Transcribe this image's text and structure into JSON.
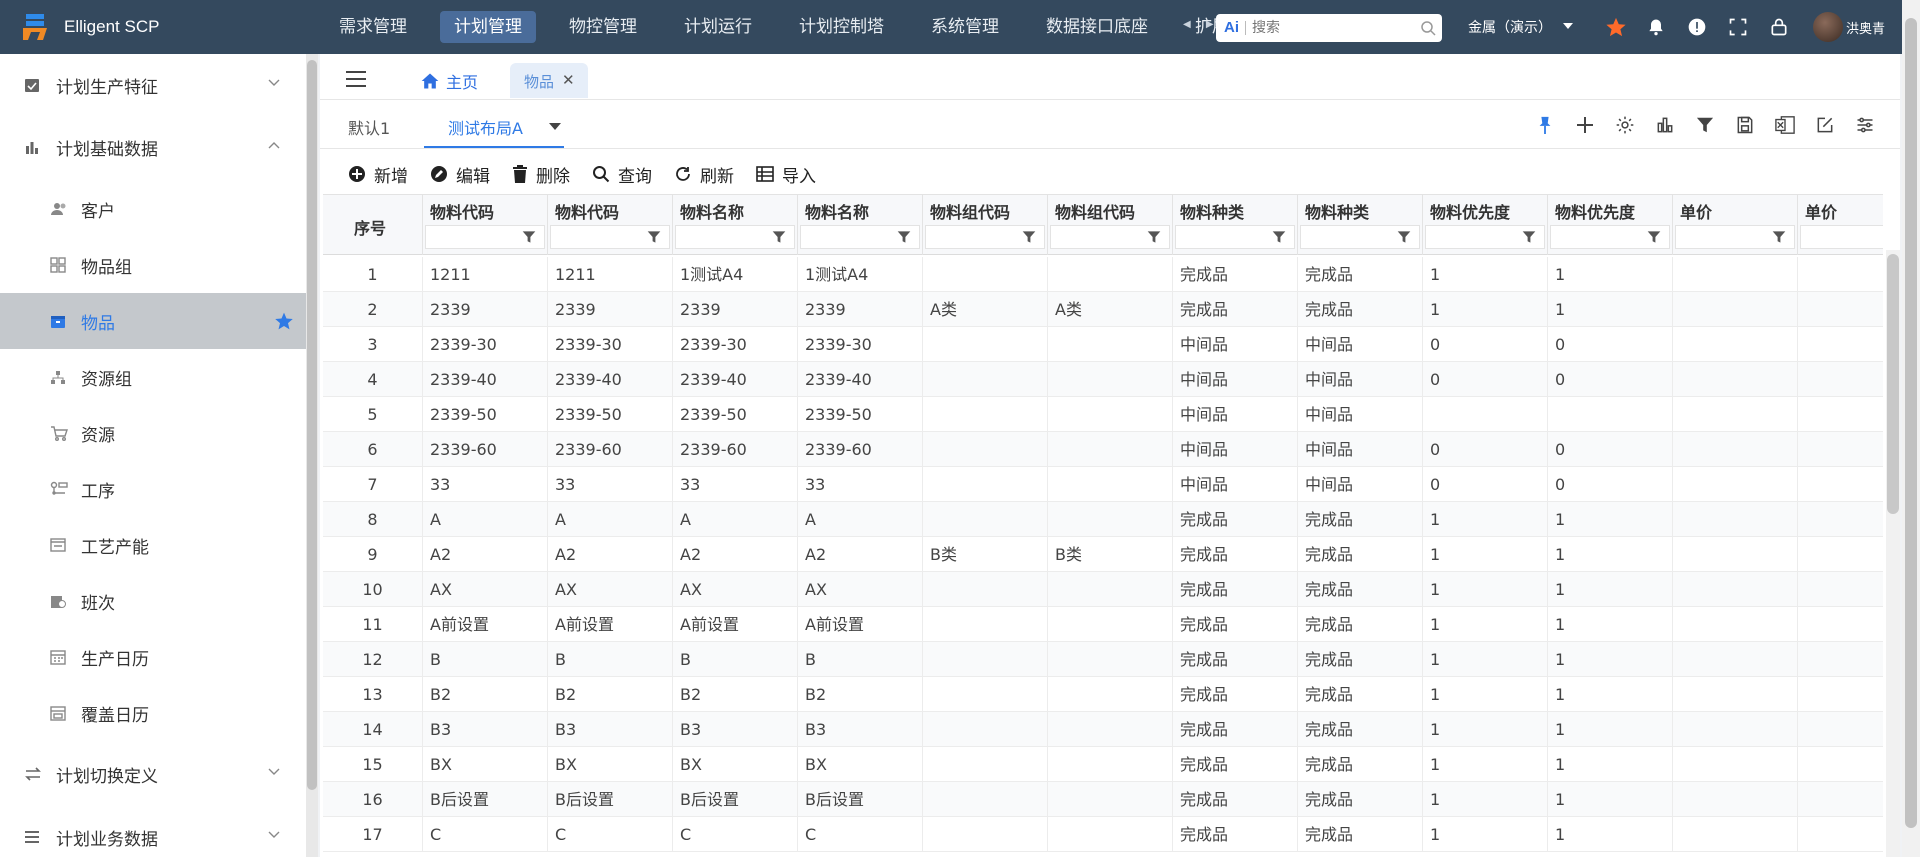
{
  "app": {
    "title": "Elligent SCP"
  },
  "topnav": [
    "需求管理",
    "计划管理",
    "物控管理",
    "计划运行",
    "计划控制塔",
    "系统管理",
    "数据接口底座",
    "扩展"
  ],
  "topnav_active": 1,
  "search": {
    "placeholder": "搜索"
  },
  "tenant": "金属（演示）",
  "user": {
    "name": "洪奥青"
  },
  "sidebar": {
    "groups": [
      {
        "label": "计划生产特征",
        "icon": "calendar-check-icon",
        "expanded": false
      },
      {
        "label": "计划基础数据",
        "icon": "bar-chart-icon",
        "expanded": true
      },
      {
        "label": "计划切换定义",
        "icon": "swap-icon",
        "expanded": false
      },
      {
        "label": "计划业务数据",
        "icon": "list-icon",
        "expanded": false
      }
    ],
    "items": [
      {
        "label": "客户",
        "icon": "users-icon"
      },
      {
        "label": "物品组",
        "icon": "grid-icon"
      },
      {
        "label": "物品",
        "icon": "box-icon",
        "active": true
      },
      {
        "label": "资源组",
        "icon": "hierarchy-icon"
      },
      {
        "label": "资源",
        "icon": "cart-icon"
      },
      {
        "label": "工序",
        "icon": "process-icon"
      },
      {
        "label": "工艺产能",
        "icon": "window-icon"
      },
      {
        "label": "班次",
        "icon": "shift-icon"
      },
      {
        "label": "生产日历",
        "icon": "calendar-icon"
      },
      {
        "label": "覆盖日历",
        "icon": "calendar-tab-icon"
      }
    ]
  },
  "tabs": {
    "home": "主页",
    "current": "物品"
  },
  "layouts": {
    "tab1": "默认1",
    "tab2": "测试布局A"
  },
  "actions": [
    "新增",
    "编辑",
    "删除",
    "查询",
    "刷新",
    "导入"
  ],
  "grid": {
    "columns": [
      "序号",
      "物料代码",
      "物料代码",
      "物料名称",
      "物料名称",
      "物料组代码",
      "物料组代码",
      "物料种类",
      "物料种类",
      "物料优先度",
      "物料优先度",
      "单价",
      "单价"
    ],
    "rows": [
      [
        "1",
        "1211",
        "1211",
        "1测试A4",
        "1测试A4",
        "",
        "",
        "完成品",
        "完成品",
        "1",
        "1",
        "",
        ""
      ],
      [
        "2",
        "2339",
        "2339",
        "2339",
        "2339",
        "A类",
        "A类",
        "完成品",
        "完成品",
        "1",
        "1",
        "",
        ""
      ],
      [
        "3",
        "2339-30",
        "2339-30",
        "2339-30",
        "2339-30",
        "",
        "",
        "中间品",
        "中间品",
        "0",
        "0",
        "",
        ""
      ],
      [
        "4",
        "2339-40",
        "2339-40",
        "2339-40",
        "2339-40",
        "",
        "",
        "中间品",
        "中间品",
        "0",
        "0",
        "",
        ""
      ],
      [
        "5",
        "2339-50",
        "2339-50",
        "2339-50",
        "2339-50",
        "",
        "",
        "中间品",
        "中间品",
        "",
        "",
        "",
        ""
      ],
      [
        "6",
        "2339-60",
        "2339-60",
        "2339-60",
        "2339-60",
        "",
        "",
        "中间品",
        "中间品",
        "0",
        "0",
        "",
        ""
      ],
      [
        "7",
        "33",
        "33",
        "33",
        "33",
        "",
        "",
        "中间品",
        "中间品",
        "0",
        "0",
        "",
        ""
      ],
      [
        "8",
        "A",
        "A",
        "A",
        "A",
        "",
        "",
        "完成品",
        "完成品",
        "1",
        "1",
        "",
        ""
      ],
      [
        "9",
        "A2",
        "A2",
        "A2",
        "A2",
        "B类",
        "B类",
        "完成品",
        "完成品",
        "1",
        "1",
        "",
        ""
      ],
      [
        "10",
        "AX",
        "AX",
        "AX",
        "AX",
        "",
        "",
        "完成品",
        "完成品",
        "1",
        "1",
        "",
        ""
      ],
      [
        "11",
        "A前设置",
        "A前设置",
        "A前设置",
        "A前设置",
        "",
        "",
        "完成品",
        "完成品",
        "1",
        "1",
        "",
        ""
      ],
      [
        "12",
        "B",
        "B",
        "B",
        "B",
        "",
        "",
        "完成品",
        "完成品",
        "1",
        "1",
        "",
        ""
      ],
      [
        "13",
        "B2",
        "B2",
        "B2",
        "B2",
        "",
        "",
        "完成品",
        "完成品",
        "1",
        "1",
        "",
        ""
      ],
      [
        "14",
        "B3",
        "B3",
        "B3",
        "B3",
        "",
        "",
        "完成品",
        "完成品",
        "1",
        "1",
        "",
        ""
      ],
      [
        "15",
        "BX",
        "BX",
        "BX",
        "BX",
        "",
        "",
        "完成品",
        "完成品",
        "1",
        "1",
        "",
        ""
      ],
      [
        "16",
        "B后设置",
        "B后设置",
        "B后设置",
        "B后设置",
        "",
        "",
        "完成品",
        "完成品",
        "1",
        "1",
        "",
        ""
      ],
      [
        "17",
        "C",
        "C",
        "C",
        "C",
        "",
        "",
        "完成品",
        "完成品",
        "1",
        "1",
        "",
        ""
      ]
    ]
  },
  "colors": {
    "topbar": "#34495e",
    "accent": "#2f7ae5",
    "star": "#ff6a2a",
    "active_nav": "#4a6c9a"
  }
}
